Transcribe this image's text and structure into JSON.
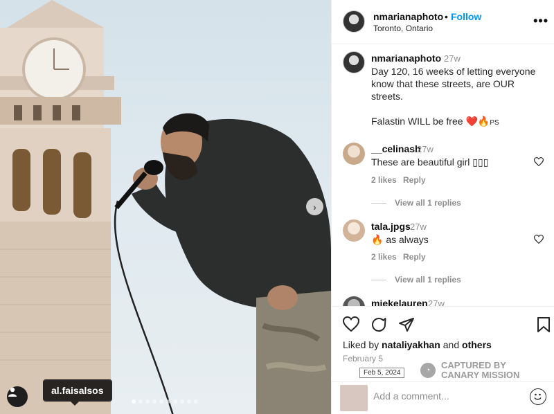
{
  "post": {
    "username": "nmarianaphoto",
    "dot": "•",
    "follow_label": "Follow",
    "location": "Toronto, Ontario",
    "more_label": "•••",
    "caption_time": "27w",
    "caption_line1": "Day 120, 16 weeks of letting everyone",
    "caption_line2": "know that these streets, are OUR",
    "caption_line3": "streets.",
    "caption_line4": "Falastin WILL be free",
    "caption_emoji": "❤️🔥",
    "caption_ps": "PS"
  },
  "photo": {
    "tag_label": "al.faisalsos",
    "next_label": "›",
    "slide_count": 10,
    "active_slide": 1
  },
  "comments": [
    {
      "username": "__celinash",
      "time": "27w",
      "text": "These are beautiful girl ▯▯▯",
      "likes": "2 likes",
      "reply": "Reply",
      "view_replies": "View all 1 replies"
    },
    {
      "username": "tala.jpgs",
      "time": "27w",
      "text": "🔥 as always",
      "likes": "2 likes",
      "reply": "Reply",
      "view_replies": "View all 1 replies"
    },
    {
      "username": "miekelauren",
      "time": "27w"
    }
  ],
  "footer": {
    "liked_prefix": "Liked by",
    "liked_user": "nataliyakhan",
    "liked_and": "and",
    "liked_others": "others",
    "date": "February 5",
    "stamp": "Feb 5, 2024",
    "captured_line1": "CAPTURED BY",
    "captured_line2": "CANARY MISSION",
    "comment_placeholder": "Add a comment..."
  },
  "colors": {
    "accent": "#0095f6",
    "text": "#262626",
    "muted": "#8e8e8e"
  }
}
